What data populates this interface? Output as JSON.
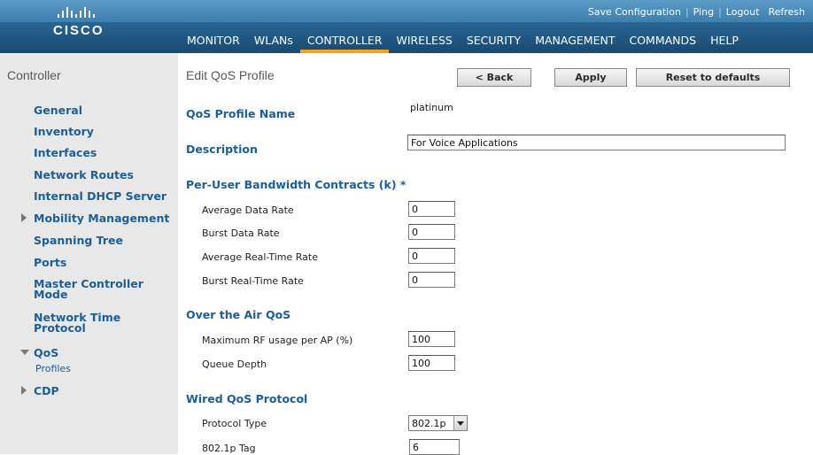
{
  "header": {
    "logo_text": "CISCO",
    "util_links": [
      "Save Configuration",
      "Ping",
      "Logout",
      "Refresh"
    ],
    "menu": [
      "MONITOR",
      "WLANs",
      "CONTROLLER",
      "WIRELESS",
      "SECURITY",
      "MANAGEMENT",
      "COMMANDS",
      "HELP"
    ],
    "active_menu": "CONTROLLER"
  },
  "sidebar": {
    "title": "Controller",
    "items": [
      "General",
      "Inventory",
      "Interfaces",
      "Network Routes",
      "Internal DHCP Server",
      "Mobility Management",
      "Spanning Tree",
      "Ports",
      "Master Controller Mode",
      "Network Time Protocol",
      "QoS",
      "CDP"
    ],
    "qos_sub": "Profiles"
  },
  "main": {
    "title": "Edit QoS Profile",
    "buttons": {
      "back": "< Back",
      "apply": "Apply",
      "reset": "Reset to defaults"
    },
    "profile_name_label": "QoS Profile Name",
    "profile_name_value": "platinum",
    "description_label": "Description",
    "description_value": "For Voice Applications",
    "bandwidth_section": "Per-User Bandwidth Contracts (k) *",
    "bandwidth_fields": [
      {
        "label": "Average Data Rate",
        "value": "0"
      },
      {
        "label": "Burst Data Rate",
        "value": "0"
      },
      {
        "label": "Average Real-Time Rate",
        "value": "0"
      },
      {
        "label": "Burst Real-Time Rate",
        "value": "0"
      }
    ],
    "air_section": "Over the Air QoS",
    "air_fields": [
      {
        "label": "Maximum RF usage per AP (%)",
        "value": "100"
      },
      {
        "label": "Queue Depth",
        "value": "100"
      }
    ],
    "wired_section": "Wired QoS Protocol",
    "protocol_type_label": "Protocol Type",
    "protocol_type_value": "802.1p",
    "tag_label": "802.1p Tag",
    "tag_value": "6"
  }
}
